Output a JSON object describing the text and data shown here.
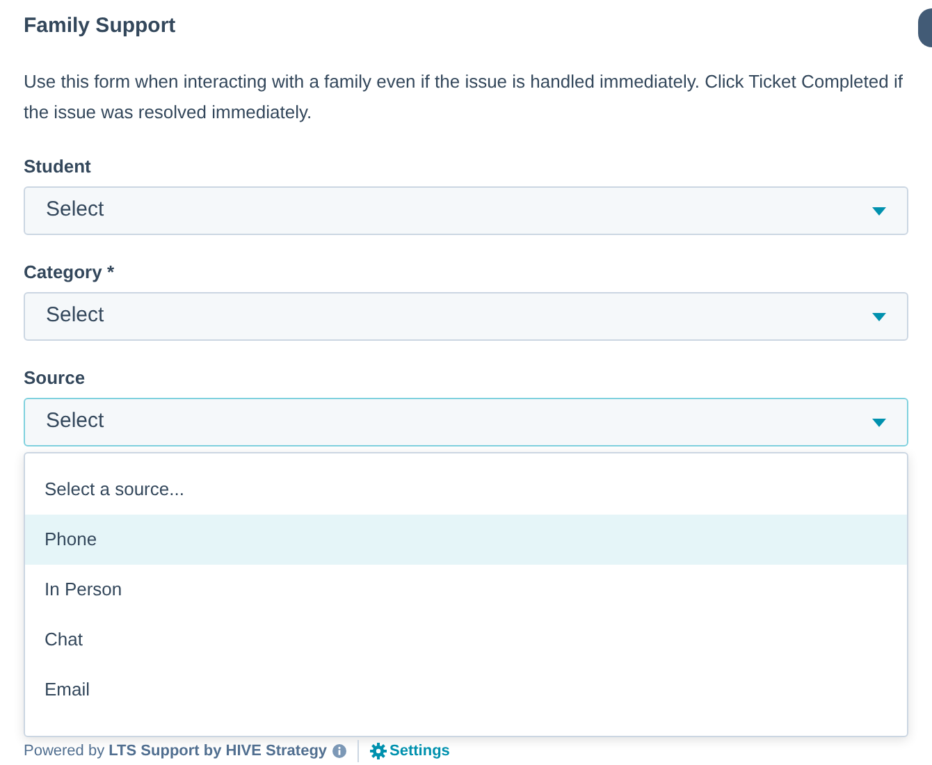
{
  "title": "Family Support",
  "description": "Use this form when interacting with a family even if the issue is handled immediately. Click Ticket Completed if the issue was resolved immediately.",
  "fields": [
    {
      "label": "Student",
      "value": "Select",
      "open": false
    },
    {
      "label": "Category *",
      "value": "Select",
      "open": false
    },
    {
      "label": "Source",
      "value": "Select",
      "open": true
    }
  ],
  "dropdown": {
    "options": [
      {
        "label": "Select a source...",
        "selected": false
      },
      {
        "label": "Phone",
        "selected": true
      },
      {
        "label": "In Person",
        "selected": false
      },
      {
        "label": "Chat",
        "selected": false
      },
      {
        "label": "Email",
        "selected": false
      }
    ]
  },
  "footer": {
    "powered": "Powered by **LTS Support by HIVE Strategy**",
    "settings": "Settings"
  }
}
